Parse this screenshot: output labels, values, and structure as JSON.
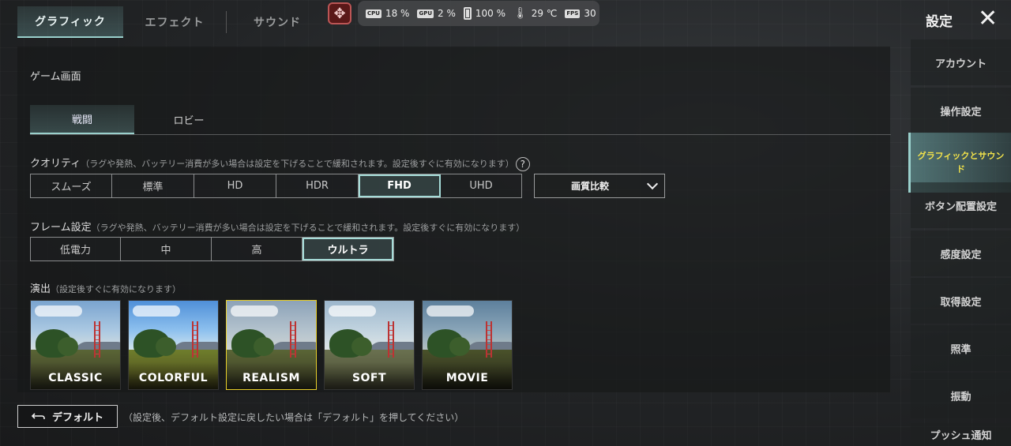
{
  "top_tabs": [
    "グラフィック",
    "エフェクト",
    "サウンド"
  ],
  "status": {
    "cpu_label": "CPU",
    "cpu": "18 %",
    "gpu_label": "GPU",
    "gpu": "2 %",
    "battery": "100 %",
    "temp": "29 ℃",
    "fps_label": "FPS",
    "fps": "30"
  },
  "header": {
    "title": "設定",
    "close": "✕"
  },
  "section_title": "ゲーム画面",
  "sub_tabs": [
    "戦闘",
    "ロビー"
  ],
  "quality": {
    "label": "クオリティ",
    "note": "（ラグや発熱、バッテリー消費が多い場合は設定を下げることで緩和されます。設定後すぐに有効になります）",
    "options": [
      "スムーズ",
      "標準",
      "HD",
      "HDR",
      "FHD",
      "UHD"
    ],
    "selected": "FHD",
    "compare_label": "画質比較"
  },
  "frame": {
    "label": "フレーム設定",
    "note": "（ラグや発熱、バッテリー消費が多い場合は設定を下げることで緩和されます。設定後すぐに有効になります）",
    "options": [
      "低電力",
      "中",
      "高",
      "ウルトラ"
    ],
    "selected": "ウルトラ"
  },
  "style": {
    "label": "演出",
    "note": "（設定後すぐに有効になります）",
    "presets": [
      "CLASSIC",
      "COLORFUL",
      "REALISM",
      "SOFT",
      "MOVIE"
    ],
    "selected": "REALISM"
  },
  "footer": {
    "default_label": "デフォルト",
    "note": "（設定後、デフォルト設定に戻したい場合は「デフォルト」を押してください）"
  },
  "sidebar": {
    "items": [
      "アカウント",
      "操作設定",
      "グラフィックとサウンド",
      "ボタン配置設定",
      "感度設定",
      "取得設定",
      "照準",
      "振動",
      "プッシュ通知"
    ],
    "active": "グラフィックとサウンド"
  }
}
